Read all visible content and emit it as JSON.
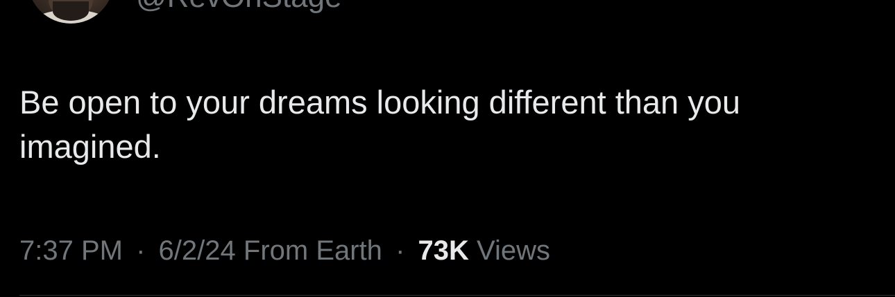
{
  "author": {
    "handle": "@RevOnStage"
  },
  "tweet": {
    "text": "Be open to your dreams looking different than you imagined."
  },
  "meta": {
    "time": "7:37 PM",
    "separator": "·",
    "date": "6/2/24",
    "source": "From Earth",
    "views_count": "73K",
    "views_label": "Views"
  },
  "colors": {
    "background": "#000000",
    "primary_text": "#e7e9ea",
    "secondary_text": "#71767b",
    "divider": "#2f3336"
  }
}
